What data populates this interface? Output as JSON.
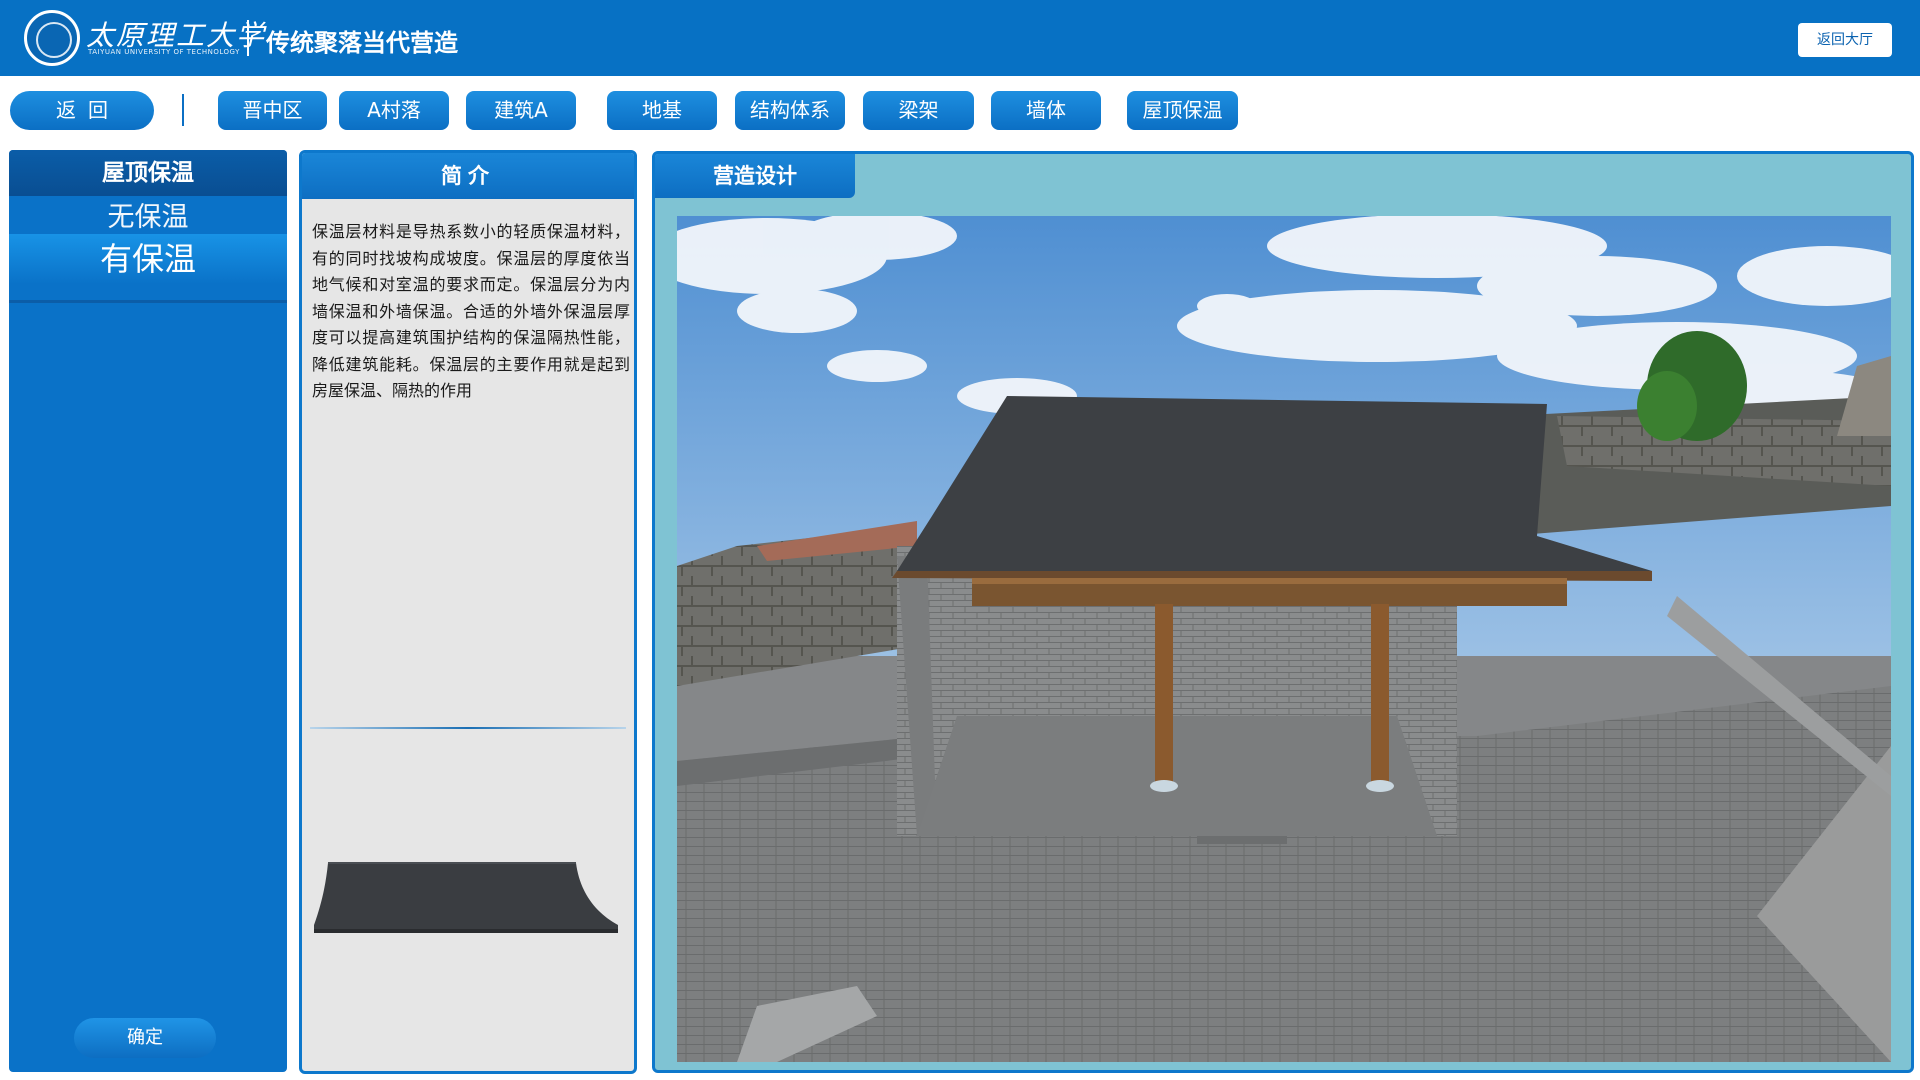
{
  "header": {
    "university_name": "太原理工大学",
    "university_sub": "TAIYUAN UNIVERSITY OF TECHNOLOGY",
    "app_title": "传统聚落当代营造",
    "return_hall_label": "返回大厅"
  },
  "toolbar": {
    "back_label": "返回",
    "items": [
      "晋中区",
      "A村落",
      "建筑A",
      "地基",
      "结构体系",
      "梁架",
      "墙体",
      "屋顶保温"
    ]
  },
  "left_panel": {
    "title": "屋顶保温",
    "options": [
      "无保温",
      "有保温"
    ],
    "selected": "有保温",
    "confirm_label": "确定"
  },
  "intro_panel": {
    "title": "简介",
    "text": "保温层材料是导热系数小的轻质保温材料，有的同时找坡构成坡度。保温层的厚度依当地气候和对室温的要求而定。保温层分为内墙保温和外墙保温。合适的外墙外保温层厚度可以提高建筑围护结构的保温隔热性能，降低建筑能耗。保温层的主要作用就是起到房屋保温、隔热的作用"
  },
  "main_panel": {
    "tab_label": "营造设计"
  },
  "colors": {
    "header_blue": "#0771c4",
    "panel_blue": "#0a72c8",
    "roof_dark": "#3d4044",
    "beam_wood": "#8b5a2e",
    "sky": "#6fa3d8"
  }
}
